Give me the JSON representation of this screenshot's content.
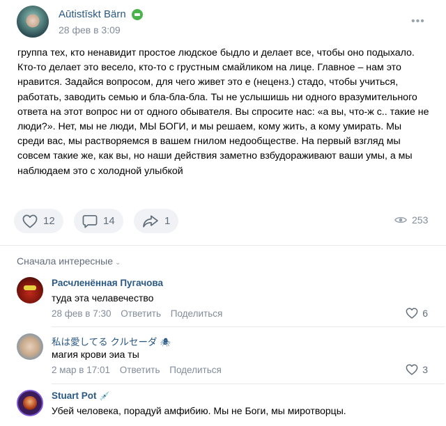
{
  "post": {
    "author": "Aūtistīskt Bärn",
    "date": "28 фев в 3:09",
    "text": "группа тех, кто ненавидит простое людское быдло и делает все, чтобы оно подыхало. Кто-то делает это весело, кто-то с грустным смайликом на лице. Главное – нам это нравится. Задайся вопросом, для чего живет это е (неценз.) стадо, чтобы учиться, работать, заводить семью и бла-бла-бла. Ты не услышишь ни одного вразумительного ответа на этот вопрос ни от одного обывателя. Вы спросите нас: «а вы, что-ж с.. такие не люди?». Нет, мы не люди, МЫ БОГИ, и мы решаем, кому жить, а кому умирать. Мы среди вас, мы растворяемся в вашем гнилом недообществе. На первый взгляд мы совсем такие же, как вы, но наши действия заметно взбудораживают ваши умы, а мы наблюдаем это с холодной улыбкой",
    "likes": "12",
    "comments": "14",
    "shares": "1",
    "views": "253"
  },
  "sort_label": "Сначала интересные",
  "comments": [
    {
      "name": "Расчленённая Пугачова",
      "text": "туда эта челавечество",
      "date": "28 фев в 7:30",
      "reply": "Ответить",
      "share": "Поделиться",
      "likes": "6"
    },
    {
      "name": "私は愛してる クルセーダ",
      "name_emoji": "🕷",
      "text": "магия крови эиа ты",
      "date": "2 мар в 17:01",
      "reply": "Ответить",
      "share": "Поделиться",
      "likes": "3"
    },
    {
      "name": "Stuart Pot",
      "name_emoji": "💉",
      "text": "Убей человека, порадуй амфибию. Мы не Боги, мы миротворцы."
    }
  ],
  "colors": {
    "link": "#2a5885",
    "meta": "#818c99",
    "verified": "#4bb34b",
    "button_bg": "#f0f2f5"
  }
}
